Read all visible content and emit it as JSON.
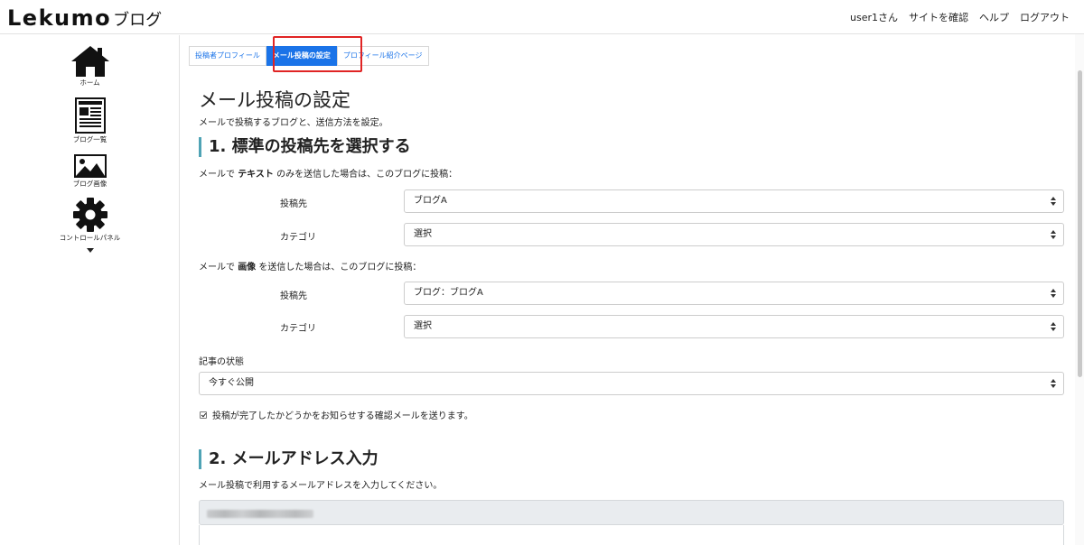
{
  "header": {
    "logo_main": "Lekumo",
    "logo_sub": "ブログ",
    "nav": [
      "user1さん",
      "サイトを確認",
      "ヘルプ",
      "ログアウト"
    ]
  },
  "sidebar": {
    "items": [
      {
        "label": "ホーム",
        "icon": "home-icon"
      },
      {
        "label": "ブログ一覧",
        "icon": "blog-list-icon"
      },
      {
        "label": "ブログ画像",
        "icon": "image-icon"
      },
      {
        "label": "コントロールパネル",
        "icon": "gear-icon"
      }
    ]
  },
  "tabs": [
    {
      "label": "投稿者プロフィール",
      "active": false
    },
    {
      "label": "メール投稿の設定",
      "active": true
    },
    {
      "label": "プロフィール紹介ページ",
      "active": false
    }
  ],
  "page": {
    "title": "メール投稿の設定",
    "description": "メールで投稿するブログと、送信方法を設定。"
  },
  "section1": {
    "title": "1. 標準の投稿先を選択する",
    "text_note_pre": "メールで",
    "text_note_bold": "テキスト",
    "text_note_post": "のみを送信した場合は、このブログに投稿：",
    "text_dest_label": "投稿先",
    "text_dest_value": "ブログA",
    "text_cat_label": "カテゴリ",
    "text_cat_value": "選択",
    "image_note_pre": "メールで",
    "image_note_bold": "画像",
    "image_note_post": "を送信した場合は、このブログに投稿：",
    "image_dest_label": "投稿先",
    "image_dest_value": "ブログ：ブログA",
    "image_cat_label": "カテゴリ",
    "image_cat_value": "選択",
    "status_label": "記事の状態",
    "status_value": "今すぐ公開",
    "confirm_checkbox_label": "投稿が完了したかどうかをお知らせする確認メールを送ります。",
    "confirm_checked": true
  },
  "section2": {
    "title": "2. メールアドレス入力",
    "description": "メール投稿で利用するメールアドレスを入力してください。"
  },
  "colors": {
    "accent": "#1a73e8",
    "highlight_border": "#e02424",
    "section_bar": "#4fa3b5"
  }
}
